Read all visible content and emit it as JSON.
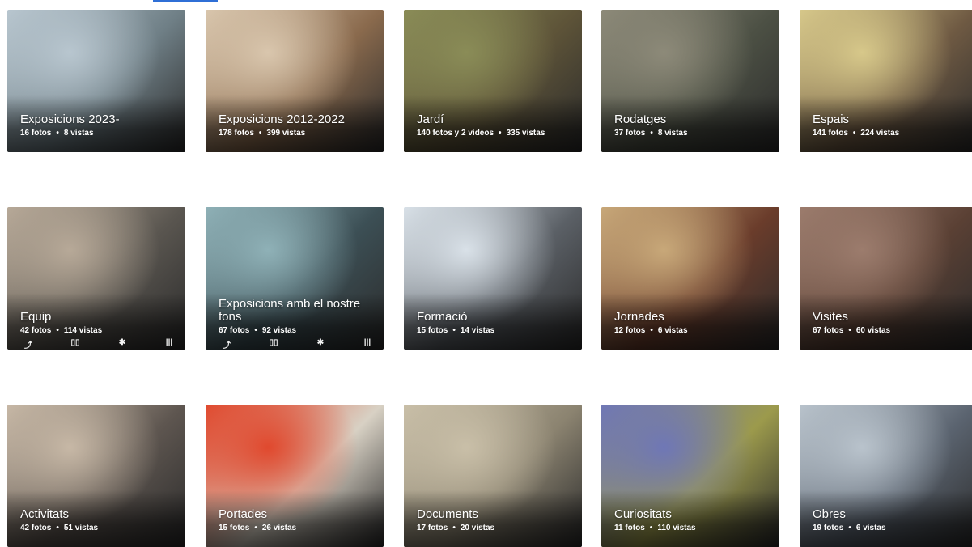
{
  "albums": [
    {
      "title": "Exposicions 2023-",
      "photos": "16 fotos",
      "views": "8 vistas",
      "bg": "#6f7f86",
      "hi": "#b8c6cf"
    },
    {
      "title": "Exposicions 2012-2022",
      "photos": "178 fotos",
      "views": "399 vistas",
      "bg": "#8a6a4d",
      "hi": "#d9c6ad"
    },
    {
      "title": "Jardí",
      "photos": "140 fotos y 2 videos",
      "views": "335 vistas",
      "bg": "#5d5338",
      "hi": "#8a8c57"
    },
    {
      "title": "Rodatges",
      "photos": "37 fotos",
      "views": "8 vistas",
      "bg": "#4c5044",
      "hi": "#8d8a79"
    },
    {
      "title": "Espais",
      "photos": "141 fotos",
      "views": "224 vistas",
      "bg": "#6f5a43",
      "hi": "#d7c88a"
    },
    {
      "title": "Equip",
      "photos": "42 fotos",
      "views": "114 vistas",
      "bg": "#5a5650",
      "hi": "#b7a998"
    },
    {
      "title": "Exposicions amb el nostre fons",
      "photos": "67 fotos",
      "views": "92 vistas",
      "bg": "#3c4f55",
      "hi": "#8fb1b7"
    },
    {
      "title": "Formació",
      "photos": "15 fotos",
      "views": "14 vistas",
      "bg": "#5b6066",
      "hi": "#d9e1e8"
    },
    {
      "title": "Jornades",
      "photos": "12 fotos",
      "views": "6 vistas",
      "bg": "#6a3c2b",
      "hi": "#c8a879"
    },
    {
      "title": "Visites",
      "photos": "67 fotos",
      "views": "60 vistas",
      "bg": "#5a4034",
      "hi": "#9c7c6d"
    },
    {
      "title": "Activitats",
      "photos": "42 fotos",
      "views": "51 vistas",
      "bg": "#5e5650",
      "hi": "#c7b8a6"
    },
    {
      "title": "Portades",
      "photos": "15 fotos",
      "views": "26 vistas",
      "bg": "#d8d1c4",
      "hi": "#e0492e"
    },
    {
      "title": "Documents",
      "photos": "17 fotos",
      "views": "20 vistas",
      "bg": "#8b8370",
      "hi": "#c9bfa8"
    },
    {
      "title": "Curiositats",
      "photos": "11 fotos",
      "views": "110 vistas",
      "bg": "#9c9a4c",
      "hi": "#6f77b6"
    },
    {
      "title": "Obres",
      "photos": "19 fotos",
      "views": "6 vistas",
      "bg": "#5b6470",
      "hi": "#b9c3cc"
    }
  ]
}
